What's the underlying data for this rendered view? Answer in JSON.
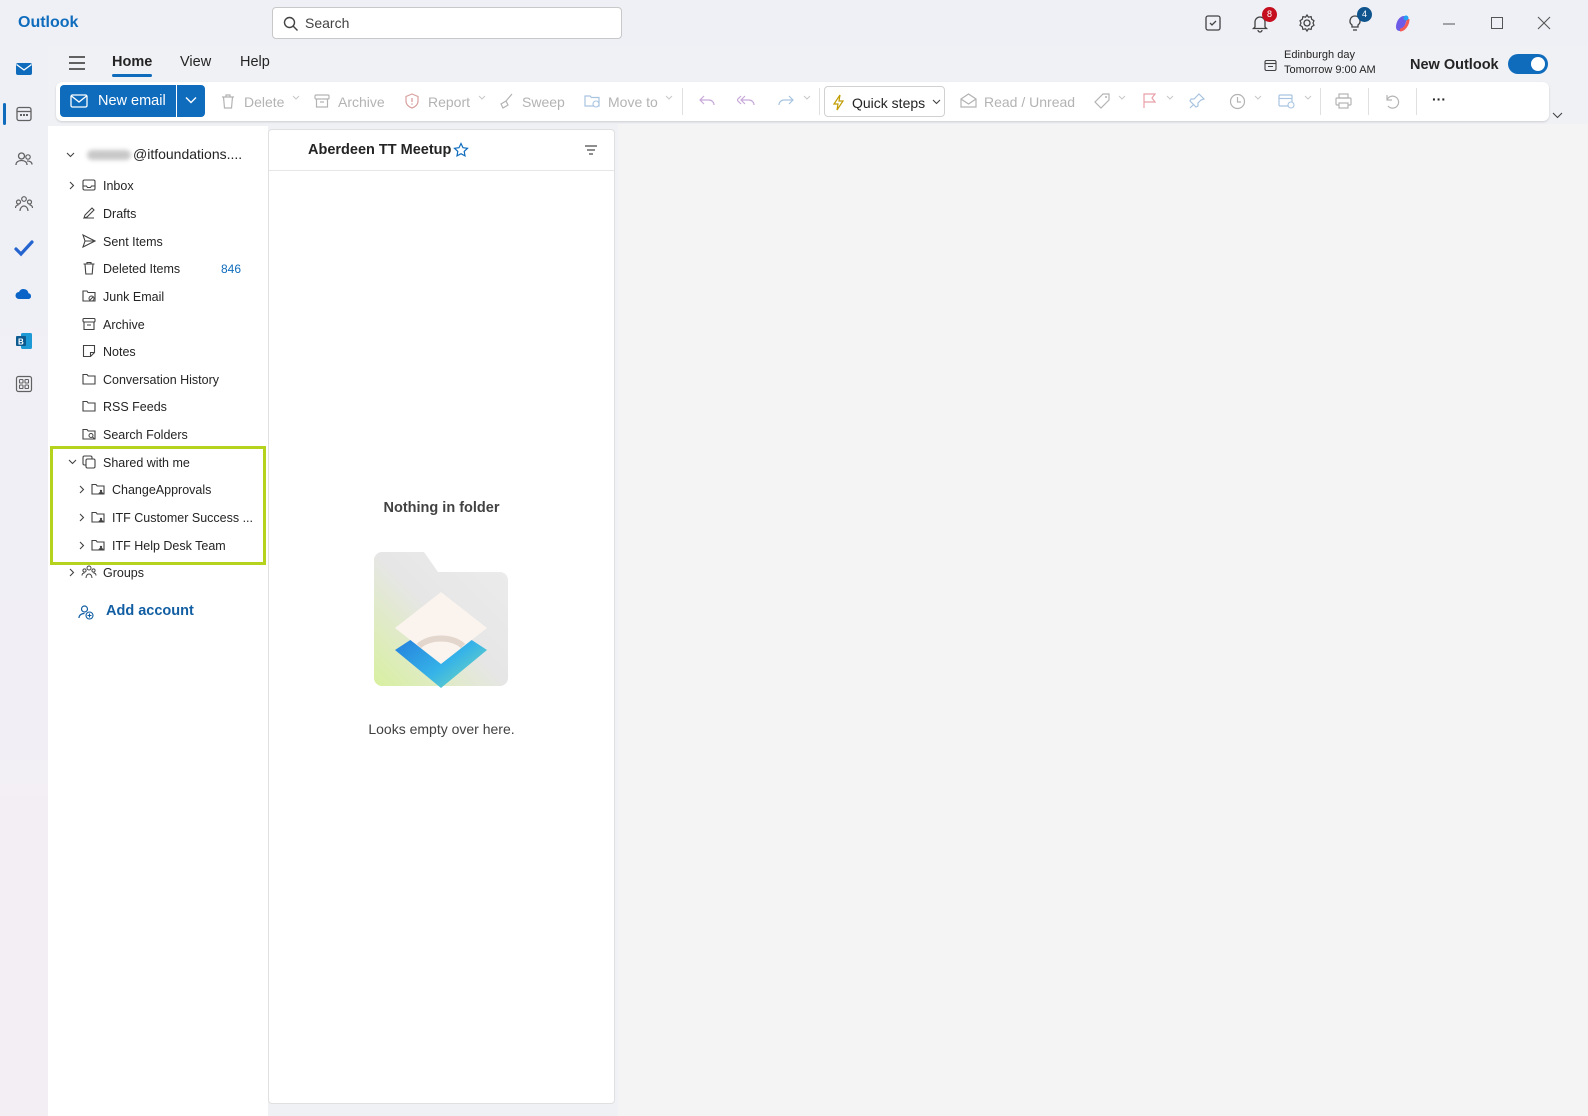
{
  "app": {
    "name": "Outlook"
  },
  "search": {
    "placeholder": "Search"
  },
  "titlebar": {
    "notifications_count": "8",
    "tips_count": "4"
  },
  "ribbon_tabs": [
    {
      "label": "Home",
      "active": true
    },
    {
      "label": "View",
      "active": false
    },
    {
      "label": "Help",
      "active": false
    }
  ],
  "day_widget": {
    "title": "Edinburgh day",
    "time": "Tomorrow 9:00 AM"
  },
  "new_outlook": {
    "label": "New Outlook",
    "enabled": true
  },
  "ribbon": {
    "new_email": "New email",
    "delete": "Delete",
    "archive": "Archive",
    "report": "Report",
    "sweep": "Sweep",
    "move_to": "Move to",
    "quick_steps": "Quick steps",
    "read_unread": "Read / Unread",
    "more": "···"
  },
  "account": {
    "email_suffix": "@itfoundations...."
  },
  "folders": [
    {
      "label": "Inbox",
      "icon": "inbox-icon",
      "expandable": true
    },
    {
      "label": "Drafts",
      "icon": "pencil-icon"
    },
    {
      "label": "Sent Items",
      "icon": "send-icon"
    },
    {
      "label": "Deleted Items",
      "icon": "trash-icon",
      "count": "846"
    },
    {
      "label": "Junk Email",
      "icon": "junk-icon"
    },
    {
      "label": "Archive",
      "icon": "archive-icon"
    },
    {
      "label": "Notes",
      "icon": "note-icon"
    },
    {
      "label": "Conversation History",
      "icon": "folder-icon"
    },
    {
      "label": "RSS Feeds",
      "icon": "folder-icon"
    },
    {
      "label": "Search Folders",
      "icon": "search-folder-icon"
    }
  ],
  "shared": {
    "label": "Shared with me",
    "items": [
      {
        "label": "ChangeApprovals"
      },
      {
        "label": "ITF Customer Success ..."
      },
      {
        "label": "ITF Help Desk Team"
      }
    ]
  },
  "groups": {
    "label": "Groups"
  },
  "add_account": "Add account",
  "message_list": {
    "title": "Aberdeen TT Meetup",
    "empty_title": "Nothing in folder",
    "empty_subtitle": "Looks empty over here."
  },
  "colors": {
    "accent": "#0f6cbd",
    "highlight": "#b5d31c",
    "badge_red": "#c50f1f",
    "badge_blue": "#0f548c"
  }
}
